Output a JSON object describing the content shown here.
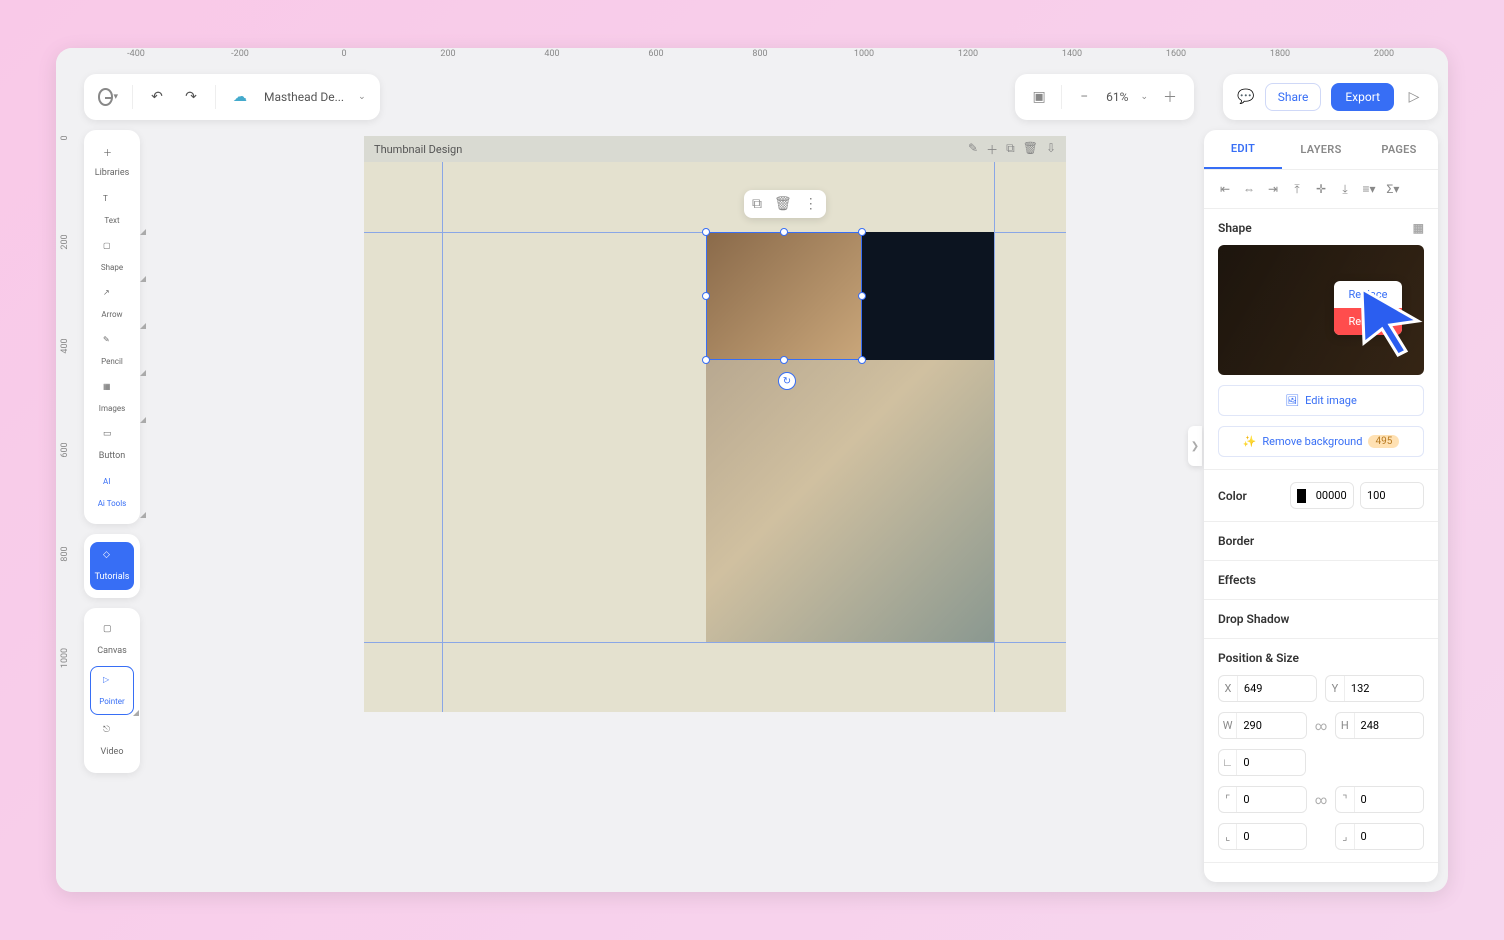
{
  "ruler_h": [
    "-400",
    "-200",
    "0",
    "200",
    "400",
    "600",
    "800",
    "1000",
    "1200",
    "1400",
    "1600",
    "1800",
    "2000"
  ],
  "ruler_v": [
    "0",
    "200",
    "400",
    "600",
    "800",
    "1000"
  ],
  "file": {
    "name": "Masthead De..."
  },
  "zoom": {
    "value": "61%"
  },
  "top_actions": {
    "share": "Share",
    "export": "Export"
  },
  "tools": {
    "libraries": "Libraries",
    "text": "Text",
    "shape": "Shape",
    "arrow": "Arrow",
    "pencil": "Pencil",
    "images": "Images",
    "button": "Button",
    "ai_tools": "Ai Tools",
    "tutorials": "Tutorials",
    "canvas": "Canvas",
    "pointer": "Pointer",
    "video": "Video"
  },
  "canvas": {
    "title": "Thumbnail Design"
  },
  "panel": {
    "tabs": {
      "edit": "EDIT",
      "layers": "LAYERS",
      "pages": "PAGES"
    },
    "shape_label": "Shape",
    "context": {
      "replace": "Replace",
      "remove": "Remove"
    },
    "edit_image": "Edit image",
    "remove_bg": "Remove background",
    "remove_bg_badge": "495",
    "color": {
      "label": "Color",
      "hex": "000000",
      "opacity": "100"
    },
    "border": "Border",
    "effects": "Effects",
    "drop_shadow": "Drop Shadow",
    "pos_size": "Position & Size",
    "x_label": "X",
    "x": "649",
    "y_label": "Y",
    "y": "132",
    "w_label": "W",
    "w": "290",
    "h_label": "H",
    "h": "248",
    "rot": "0",
    "r1": "0",
    "r2": "0",
    "r3": "0",
    "r4": "0"
  }
}
